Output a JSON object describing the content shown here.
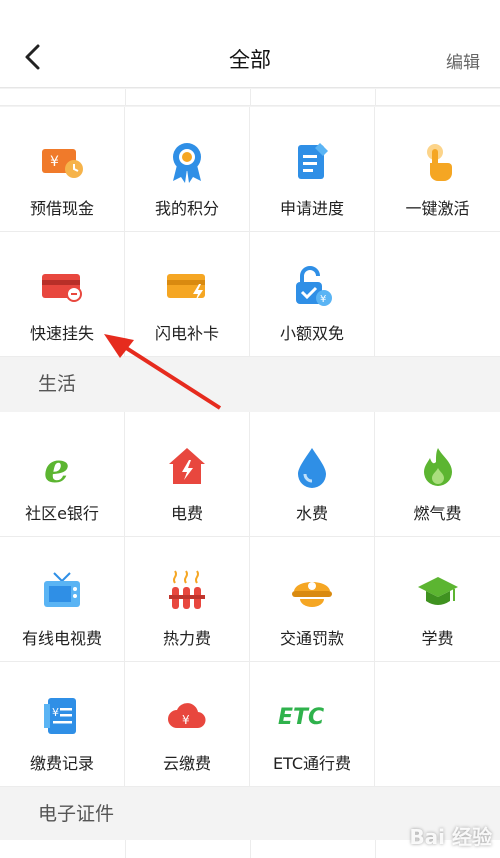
{
  "header": {
    "title": "全部",
    "edit_label": "编辑"
  },
  "sections": {
    "life": "生活",
    "documents": "电子证件"
  },
  "grid_top": [
    {
      "label": "预借现金",
      "icon": "cash-advance-icon"
    },
    {
      "label": "我的积分",
      "icon": "points-medal-icon"
    },
    {
      "label": "申请进度",
      "icon": "application-progress-icon"
    },
    {
      "label": "一键激活",
      "icon": "tap-activate-icon"
    },
    {
      "label": "快速挂失",
      "icon": "report-loss-card-icon"
    },
    {
      "label": "闪电补卡",
      "icon": "card-replace-icon"
    },
    {
      "label": "小额双免",
      "icon": "small-amount-lock-icon"
    }
  ],
  "grid_life": [
    {
      "label": "社区e银行",
      "icon": "community-e-bank-icon"
    },
    {
      "label": "电费",
      "icon": "electricity-icon"
    },
    {
      "label": "水费",
      "icon": "water-drop-icon"
    },
    {
      "label": "燃气费",
      "icon": "gas-flame-icon"
    },
    {
      "label": "有线电视费",
      "icon": "cable-tv-icon"
    },
    {
      "label": "热力费",
      "icon": "heating-icon"
    },
    {
      "label": "交通罚款",
      "icon": "traffic-fine-icon"
    },
    {
      "label": "学费",
      "icon": "graduation-cap-icon"
    },
    {
      "label": "缴费记录",
      "icon": "payment-record-icon"
    },
    {
      "label": "云缴费",
      "icon": "cloud-payment-icon"
    },
    {
      "label": "ETC通行费",
      "icon": "etc-toll-icon"
    }
  ],
  "icon_text": {
    "etc": "ETC",
    "e": "e"
  },
  "watermark": "Bai 经验",
  "colors": {
    "accent_orange": "#f5a623",
    "red": "#e8473e",
    "blue": "#2f8fe6",
    "green": "#5cb531"
  }
}
